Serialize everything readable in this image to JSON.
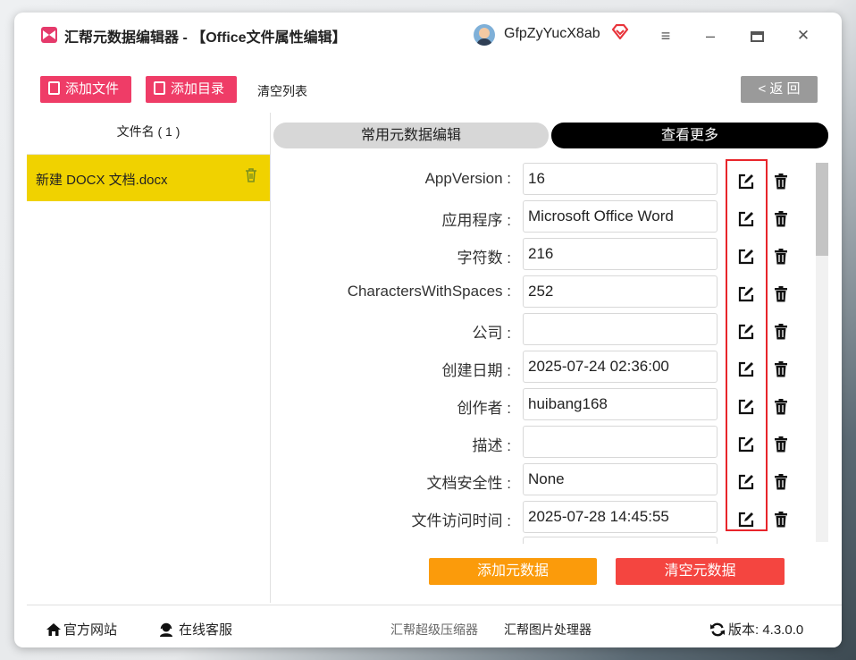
{
  "window": {
    "title": "汇帮元数据编辑器 - 【Office文件属性编辑】",
    "username": "GfpZyYucX8ab"
  },
  "toolbar": {
    "add_file": "添加文件",
    "add_dir": "添加目录",
    "clear_list": "清空列表",
    "back": "< 返 回"
  },
  "file_panel": {
    "header": "文件名 ( 1 )",
    "files": [
      {
        "name": "新建 DOCX 文档.docx"
      }
    ]
  },
  "tabs": [
    {
      "label": "常用元数据编辑",
      "active": false
    },
    {
      "label": "查看更多",
      "active": true
    }
  ],
  "metadata": [
    {
      "label": "AppVersion :",
      "value": "16"
    },
    {
      "label": "应用程序 :",
      "value": "Microsoft Office Word"
    },
    {
      "label": "字符数 :",
      "value": "216"
    },
    {
      "label": "CharactersWithSpaces :",
      "value": "252"
    },
    {
      "label": "公司 :",
      "value": ""
    },
    {
      "label": "创建日期 :",
      "value": "2025-07-24 02:36:00"
    },
    {
      "label": "创作者 :",
      "value": "huibang168"
    },
    {
      "label": "描述 :",
      "value": ""
    },
    {
      "label": "文档安全性 :",
      "value": "None"
    },
    {
      "label": "文件访问时间 :",
      "value": "2025-07-28 14:45:55"
    }
  ],
  "actions": {
    "add_meta": "添加元数据",
    "clear_meta": "清空元数据"
  },
  "footer": {
    "website": "官方网站",
    "service": "在线客服",
    "compressor": "汇帮超级压缩器",
    "image_tool": "汇帮图片处理器",
    "version": "版本: 4.3.0.0"
  },
  "colors": {
    "accent_pink": "#ef3c67",
    "selected_file": "#f0d200",
    "add_button": "#fb9b0b",
    "clear_button": "#f44540",
    "highlight_border": "#e8252b"
  }
}
